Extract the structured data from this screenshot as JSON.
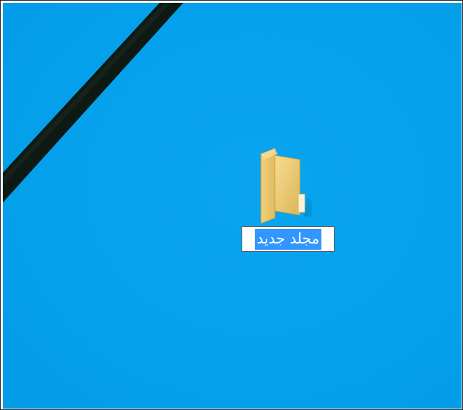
{
  "desktop": {
    "background_color": "#05a1ec",
    "stripe_color": "#0d1a14",
    "icons": [
      {
        "icon": "folder-icon",
        "label": "مجلد جديد",
        "state": "renaming",
        "selection_color": "#3296ff"
      }
    ]
  }
}
